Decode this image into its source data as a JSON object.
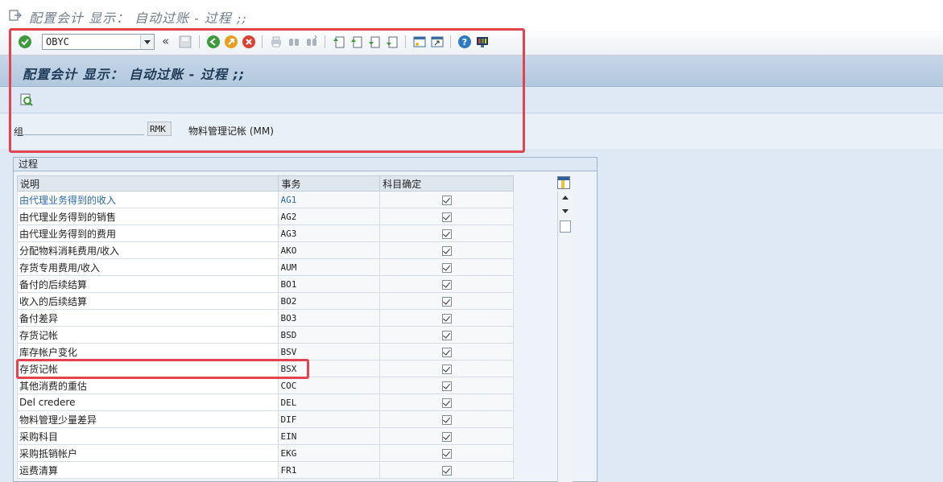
{
  "window": {
    "title": "配置会计 显示： 自动过账 - 过程 ;;"
  },
  "toolbar": {
    "command_value": "OBYC",
    "buttons": [
      {
        "name": "enter-icon",
        "color": "#3c9c3c"
      },
      {
        "name": "save-icon"
      },
      {
        "name": "back-icon",
        "color": "#3c9c3c"
      },
      {
        "name": "exit-icon",
        "color": "#e8a020"
      },
      {
        "name": "cancel-icon",
        "color": "#d94130"
      },
      {
        "name": "print-icon"
      },
      {
        "name": "find-icon"
      },
      {
        "name": "find-next-icon"
      },
      {
        "name": "first-page-icon"
      },
      {
        "name": "previous-page-icon"
      },
      {
        "name": "next-page-icon"
      },
      {
        "name": "last-page-icon"
      },
      {
        "name": "create-session-icon"
      },
      {
        "name": "generate-shortcut-icon"
      },
      {
        "name": "help-icon",
        "color": "#2f7bc2"
      },
      {
        "name": "customize-layout-icon"
      }
    ]
  },
  "header": {
    "title": "配置会计 显示： 自动过账 - 过程 ;;"
  },
  "group": {
    "label": "组",
    "value": "RMK",
    "description": "物料管理记帐 (MM)"
  },
  "panel": {
    "title": "过程"
  },
  "table": {
    "columns": [
      "说明",
      "事务",
      "科目确定"
    ],
    "rows": [
      {
        "desc": "由代理业务得到的收入",
        "code": "AG1",
        "checked": true
      },
      {
        "desc": "由代理业务得到的销售",
        "code": "AG2",
        "checked": true
      },
      {
        "desc": "由代理业务得到的费用",
        "code": "AG3",
        "checked": true
      },
      {
        "desc": "分配物料消耗费用/收入",
        "code": "AKO",
        "checked": true
      },
      {
        "desc": "存货专用费用/收入",
        "code": "AUM",
        "checked": true
      },
      {
        "desc": "备付的后续结算",
        "code": "BO1",
        "checked": true
      },
      {
        "desc": "收入的后续结算",
        "code": "BO2",
        "checked": true
      },
      {
        "desc": "备付差异",
        "code": "BO3",
        "checked": true
      },
      {
        "desc": "存货记帐",
        "code": "BSD",
        "checked": true
      },
      {
        "desc": "库存帐户变化",
        "code": "BSV",
        "checked": true
      },
      {
        "desc": "存货记帐",
        "code": "BSX",
        "checked": true
      },
      {
        "desc": "其他消费的重估",
        "code": "COC",
        "checked": true
      },
      {
        "desc": "Del credere",
        "code": "DEL",
        "checked": true
      },
      {
        "desc": "物料管理少量差异",
        "code": "DIF",
        "checked": true
      },
      {
        "desc": "采购科目",
        "code": "EIN",
        "checked": true
      },
      {
        "desc": "采购抵销帐户",
        "code": "EKG",
        "checked": true
      },
      {
        "desc": "运费清算",
        "code": "FR1",
        "checked": true
      }
    ]
  },
  "highlight": {
    "color": "#e2434e"
  }
}
